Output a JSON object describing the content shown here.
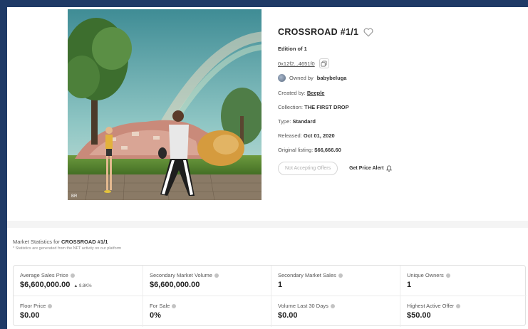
{
  "artwork": {
    "corner_mark": "BR"
  },
  "nft": {
    "title": "CROSSROAD #1/1",
    "edition": "Edition of 1",
    "address": "0x12f2...4651f0",
    "owner_prefix": "Owned by",
    "owner_name": "babybeluga",
    "created_prefix": "Created by:",
    "creator": "Beeple",
    "collection_prefix": "Collection:",
    "collection": "THE FIRST DROP",
    "type_prefix": "Type:",
    "type": "Standard",
    "released_prefix": "Released:",
    "released": "Oct 01, 2020",
    "listing_prefix": "Original listing:",
    "listing": "$66,666.60"
  },
  "buttons": {
    "offers": "Not Accepting Offers",
    "alert": "Get Price Alert"
  },
  "stats": {
    "title_prefix": "Market Statistics for",
    "title_name": "CROSSROAD #1/1",
    "note": "* Statistics are generated from the NFT activity on our platform",
    "cells": [
      {
        "label": "Average Sales Price",
        "value": "$6,600,000.00",
        "change": "▲ 9.8K%"
      },
      {
        "label": "Secondary Market Volume",
        "value": "$6,600,000.00",
        "change": ""
      },
      {
        "label": "Secondary Market Sales",
        "value": "1",
        "change": ""
      },
      {
        "label": "Unique Owners",
        "value": "1",
        "change": ""
      },
      {
        "label": "Floor Price",
        "value": "$0.00",
        "change": ""
      },
      {
        "label": "For Sale",
        "value": "0%",
        "change": ""
      },
      {
        "label": "Volume Last 30 Days",
        "value": "$0.00",
        "change": ""
      },
      {
        "label": "Highest Active Offer",
        "value": "$50.00",
        "change": ""
      }
    ]
  }
}
